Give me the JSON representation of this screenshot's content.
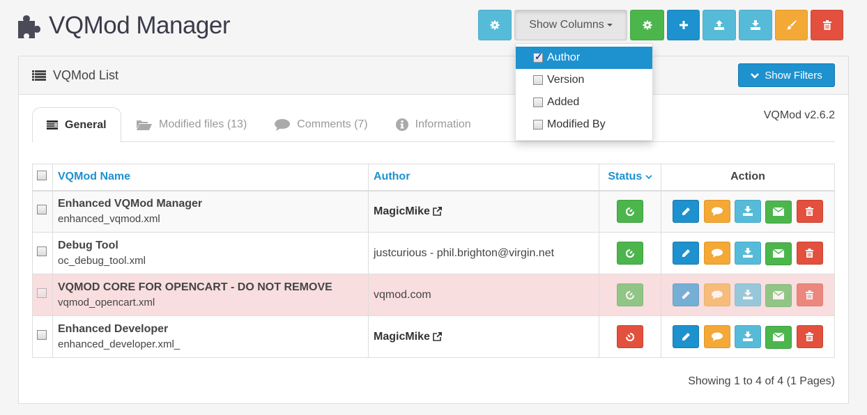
{
  "header": {
    "title": "VQMod Manager",
    "icon": "puzzle-icon"
  },
  "toolbar": {
    "buttons": [
      {
        "name": "settings",
        "icon": "gear-icon",
        "color": "#56bbd8"
      },
      {
        "name": "show-columns",
        "label": "Show Columns",
        "color": "#e6e6e6"
      },
      {
        "name": "enable-all",
        "icon": "gear-icon",
        "color": "#4cb64c"
      },
      {
        "name": "add",
        "icon": "plus-icon",
        "color": "#1e91cf"
      },
      {
        "name": "upload",
        "icon": "upload-icon",
        "color": "#56bbd8"
      },
      {
        "name": "download",
        "icon": "download-icon",
        "color": "#56bbd8"
      },
      {
        "name": "clear-cache",
        "icon": "brush-icon",
        "color": "#f4a836"
      },
      {
        "name": "delete",
        "icon": "trash-icon",
        "color": "#e3503e"
      }
    ],
    "show_columns_label": "Show Columns"
  },
  "columns_dropdown": {
    "items": [
      {
        "label": "Author",
        "checked": true,
        "active": true
      },
      {
        "label": "Version",
        "checked": false,
        "active": false
      },
      {
        "label": "Added",
        "checked": false,
        "active": false
      },
      {
        "label": "Modified By",
        "checked": false,
        "active": false
      }
    ]
  },
  "panel": {
    "title": "VQMod List",
    "show_filters_label": "Show Filters",
    "version": "VQMod v2.6.2"
  },
  "tabs": [
    {
      "label": "General",
      "icon": "list-icon",
      "active": true
    },
    {
      "label": "Modified files (13)",
      "icon": "folder-open-icon",
      "active": false
    },
    {
      "label": "Comments (7)",
      "icon": "comment-icon",
      "active": false
    },
    {
      "label": "Information",
      "icon": "info-icon",
      "active": false
    }
  ],
  "table": {
    "headers": {
      "name": "VQMod Name",
      "author": "Author",
      "status": "Status",
      "action": "Action"
    },
    "rows": [
      {
        "name": "Enhanced VQMod Manager",
        "file": "enhanced_vqmod.xml",
        "author": "MagicMike",
        "author_link": true,
        "status": "enabled",
        "state": "odd"
      },
      {
        "name": "Debug Tool",
        "file": "oc_debug_tool.xml",
        "author": "justcurious - phil.brighton@virgin.net",
        "author_link": false,
        "status": "enabled",
        "state": "normal"
      },
      {
        "name": "VQMOD CORE FOR OPENCART - DO NOT REMOVE",
        "file": "vqmod_opencart.xml",
        "author": "vqmod.com",
        "author_link": false,
        "status": "enabled",
        "state": "danger"
      },
      {
        "name": "Enhanced Developer",
        "file": "enhanced_developer.xml_",
        "author": "MagicMike",
        "author_link": true,
        "status": "disabled",
        "state": "normal"
      }
    ]
  },
  "pagination": {
    "text": "Showing 1 to 4 of 4 (1 Pages)"
  },
  "colors": {
    "primary": "#1e91cf",
    "info": "#56bbd8",
    "success": "#4cb64c",
    "warning": "#f4a836",
    "danger": "#e3503e",
    "danger_row": "#f9dedf"
  }
}
